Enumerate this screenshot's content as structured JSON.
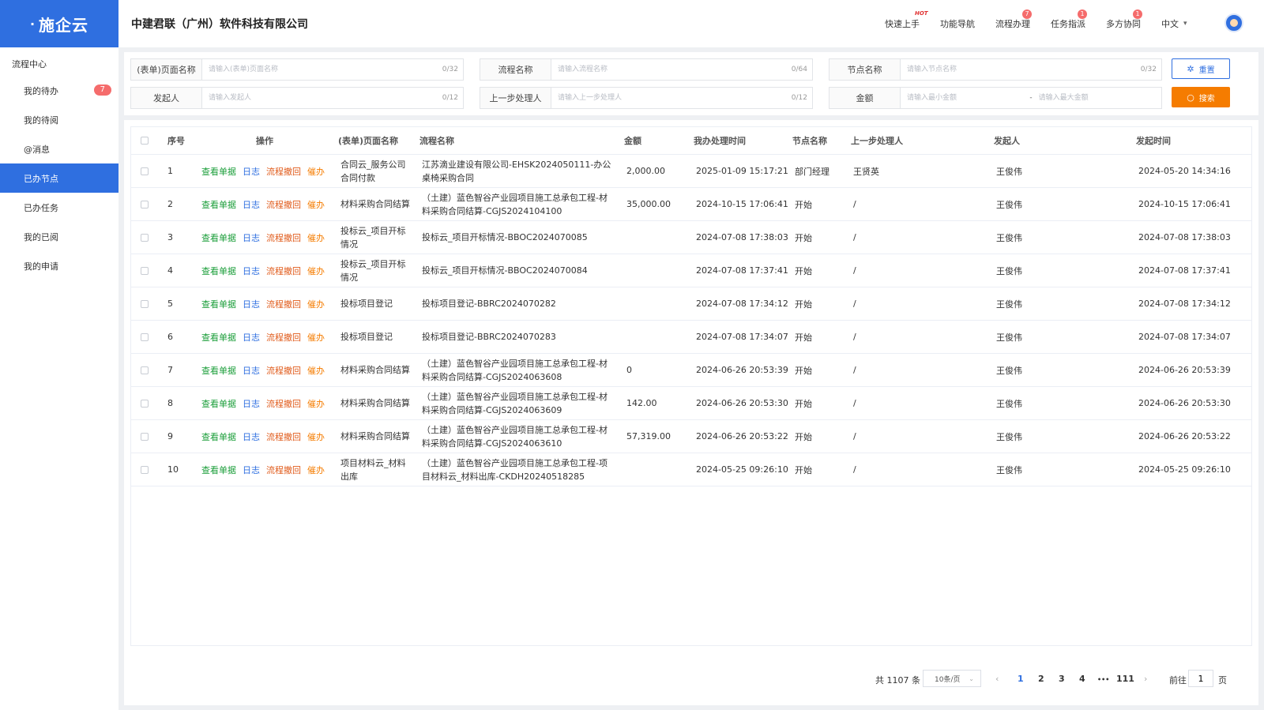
{
  "app": {
    "logo": "施企云",
    "company": "中建君联（广州）软件科技有限公司"
  },
  "sidebar": {
    "section": "流程中心",
    "items": [
      {
        "label": "我的待办",
        "badge": "7"
      },
      {
        "label": "我的待阅"
      },
      {
        "label": "@消息"
      },
      {
        "label": "已办节点",
        "active": true
      },
      {
        "label": "已办任务"
      },
      {
        "label": "我的已阅"
      },
      {
        "label": "我的申请"
      }
    ]
  },
  "header": {
    "nav": {
      "quickstart": "快速上手",
      "hot": "HOT",
      "funcnav": "功能导航",
      "process": "流程办理",
      "process_badge": "7",
      "task": "任务指派",
      "task_badge": "1",
      "collab": "多方协同",
      "collab_badge": "1",
      "lang": "中文"
    }
  },
  "filters": {
    "form_name": {
      "label": "(表单)页面名称",
      "placeholder": "请输入(表单)页面名称",
      "count": "0/32"
    },
    "flow_name": {
      "label": "流程名称",
      "placeholder": "请输入流程名称",
      "count": "0/64"
    },
    "node_name": {
      "label": "节点名称",
      "placeholder": "请输入节点名称",
      "count": "0/32"
    },
    "initiator": {
      "label": "发起人",
      "placeholder": "请输入发起人",
      "count": "0/12"
    },
    "prev_handler": {
      "label": "上一步处理人",
      "placeholder": "请输入上一步处理人",
      "count": "0/12"
    },
    "amount": {
      "label": "金额",
      "min_placeholder": "请输入最小金额",
      "sep": "-",
      "max_placeholder": "请输入最大金额"
    },
    "reset_label": "重置",
    "search_label": "搜索"
  },
  "table": {
    "columns": {
      "index": "序号",
      "ops": "操作",
      "form": "(表单)页面名称",
      "flow": "流程名称",
      "amount": "金额",
      "time": "我办处理时间",
      "node": "节点名称",
      "prev": "上一步处理人",
      "initiator": "发起人",
      "start": "发起时间"
    },
    "ops": {
      "view": "查看单据",
      "log": "日志",
      "revoke": "流程撤回",
      "urge": "催办"
    },
    "rows": [
      {
        "index": "1",
        "form": "合同云_服务公司合同付款",
        "flow": "江苏滴业建设有限公司-EHSK2024050111-办公桌椅采购合同",
        "amount": "2,000.00",
        "time": "2025-01-09 15:17:21",
        "node": "部门经理",
        "prev": "王贤英",
        "initiator": "王俊伟",
        "start": "2024-05-20 14:34:16"
      },
      {
        "index": "2",
        "form": "材料采购合同结算",
        "flow": "（土建）蓝色智谷产业园项目施工总承包工程-材料采购合同结算-CGJS2024104100",
        "amount": "35,000.00",
        "time": "2024-10-15 17:06:41",
        "node": "开始",
        "prev": "/",
        "initiator": "王俊伟",
        "start": "2024-10-15 17:06:41"
      },
      {
        "index": "3",
        "form": "投标云_项目开标情况",
        "flow": "投标云_项目开标情况-BBOC2024070085",
        "amount": "",
        "time": "2024-07-08 17:38:03",
        "node": "开始",
        "prev": "/",
        "initiator": "王俊伟",
        "start": "2024-07-08 17:38:03"
      },
      {
        "index": "4",
        "form": "投标云_项目开标情况",
        "flow": "投标云_项目开标情况-BBOC2024070084",
        "amount": "",
        "time": "2024-07-08 17:37:41",
        "node": "开始",
        "prev": "/",
        "initiator": "王俊伟",
        "start": "2024-07-08 17:37:41"
      },
      {
        "index": "5",
        "form": "投标项目登记",
        "flow": "投标项目登记-BBRC2024070282",
        "amount": "",
        "time": "2024-07-08 17:34:12",
        "node": "开始",
        "prev": "/",
        "initiator": "王俊伟",
        "start": "2024-07-08 17:34:12"
      },
      {
        "index": "6",
        "form": "投标项目登记",
        "flow": "投标项目登记-BBRC2024070283",
        "amount": "",
        "time": "2024-07-08 17:34:07",
        "node": "开始",
        "prev": "/",
        "initiator": "王俊伟",
        "start": "2024-07-08 17:34:07"
      },
      {
        "index": "7",
        "form": "材料采购合同结算",
        "flow": "（土建）蓝色智谷产业园项目施工总承包工程-材料采购合同结算-CGJS2024063608",
        "amount": "0",
        "time": "2024-06-26 20:53:39",
        "node": "开始",
        "prev": "/",
        "initiator": "王俊伟",
        "start": "2024-06-26 20:53:39"
      },
      {
        "index": "8",
        "form": "材料采购合同结算",
        "flow": "（土建）蓝色智谷产业园项目施工总承包工程-材料采购合同结算-CGJS2024063609",
        "amount": "142.00",
        "time": "2024-06-26 20:53:30",
        "node": "开始",
        "prev": "/",
        "initiator": "王俊伟",
        "start": "2024-06-26 20:53:30"
      },
      {
        "index": "9",
        "form": "材料采购合同结算",
        "flow": "（土建）蓝色智谷产业园项目施工总承包工程-材料采购合同结算-CGJS2024063610",
        "amount": "57,319.00",
        "time": "2024-06-26 20:53:22",
        "node": "开始",
        "prev": "/",
        "initiator": "王俊伟",
        "start": "2024-06-26 20:53:22"
      },
      {
        "index": "10",
        "form": "项目材料云_材料出库",
        "flow": "（土建）蓝色智谷产业园项目施工总承包工程-项目材料云_材料出库-CKDH20240518285",
        "amount": "",
        "time": "2024-05-25 09:26:10",
        "node": "开始",
        "prev": "/",
        "initiator": "王俊伟",
        "start": "2024-05-25 09:26:10"
      }
    ]
  },
  "pagination": {
    "total": "共 1107 条",
    "page_size": "10条/页",
    "pages": [
      "1",
      "2",
      "3",
      "4",
      "•••",
      "111"
    ],
    "current": "1",
    "goto": "前往",
    "goto_value": "1",
    "unit": "页"
  },
  "colors": {
    "primary": "#2f6fe0",
    "orange": "#f57c00",
    "badge": "#f56c6c",
    "green": "#1b9e3a"
  }
}
